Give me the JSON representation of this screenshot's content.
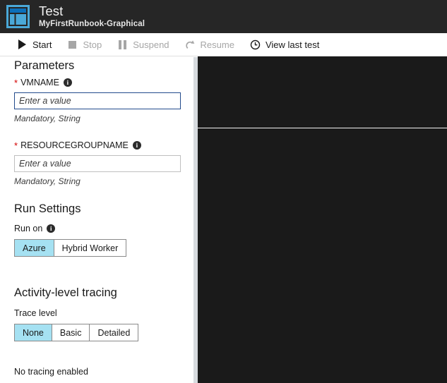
{
  "header": {
    "logo_icon": "dashboard-layout-icon",
    "title": "Test",
    "subtitle": "MyFirstRunbook-Graphical"
  },
  "toolbar": {
    "items": [
      {
        "label": "Start",
        "icon": "play-icon",
        "enabled": true
      },
      {
        "label": "Stop",
        "icon": "stop-icon",
        "enabled": false
      },
      {
        "label": "Suspend",
        "icon": "pause-icon",
        "enabled": false
      },
      {
        "label": "Resume",
        "icon": "resume-icon",
        "enabled": false
      },
      {
        "label": "View last test",
        "icon": "clock-icon",
        "enabled": true
      }
    ]
  },
  "parameters": {
    "title": "Parameters",
    "fields": [
      {
        "name": "VMNAME",
        "required_marker": "*",
        "info_icon": "info-icon",
        "placeholder": "Enter a value",
        "value": "",
        "hint": "Mandatory, String",
        "focused": true
      },
      {
        "name": "RESOURCEGROUPNAME",
        "required_marker": "*",
        "info_icon": "info-icon",
        "placeholder": "Enter a value",
        "value": "",
        "hint": "Mandatory, String",
        "focused": false
      }
    ]
  },
  "run_settings": {
    "title": "Run Settings",
    "run_on_label": "Run on",
    "info_icon": "info-icon",
    "options": [
      "Azure",
      "Hybrid Worker"
    ],
    "selected": "Azure"
  },
  "activity_tracing": {
    "title": "Activity-level tracing",
    "trace_level_label": "Trace level",
    "options": [
      "None",
      "Basic",
      "Detailed"
    ],
    "selected": "None",
    "status": "No tracing enabled"
  },
  "colors": {
    "header_bg": "#262626",
    "accent_selected": "#a5e1f2",
    "required_star": "#d40000",
    "focus_border": "#234b8c",
    "output_pane_bg": "#1a1a1a"
  }
}
